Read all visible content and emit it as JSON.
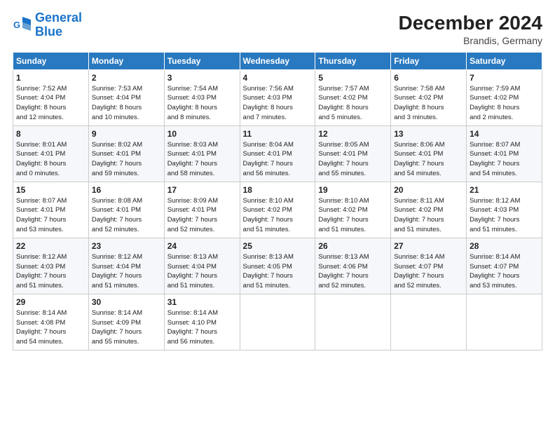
{
  "logo": {
    "line1": "General",
    "line2": "Blue"
  },
  "title": "December 2024",
  "subtitle": "Brandis, Germany",
  "weekdays": [
    "Sunday",
    "Monday",
    "Tuesday",
    "Wednesday",
    "Thursday",
    "Friday",
    "Saturday"
  ],
  "weeks": [
    [
      {
        "day": "1",
        "lines": [
          "Sunrise: 7:52 AM",
          "Sunset: 4:04 PM",
          "Daylight: 8 hours",
          "and 12 minutes."
        ]
      },
      {
        "day": "2",
        "lines": [
          "Sunrise: 7:53 AM",
          "Sunset: 4:04 PM",
          "Daylight: 8 hours",
          "and 10 minutes."
        ]
      },
      {
        "day": "3",
        "lines": [
          "Sunrise: 7:54 AM",
          "Sunset: 4:03 PM",
          "Daylight: 8 hours",
          "and 8 minutes."
        ]
      },
      {
        "day": "4",
        "lines": [
          "Sunrise: 7:56 AM",
          "Sunset: 4:03 PM",
          "Daylight: 8 hours",
          "and 7 minutes."
        ]
      },
      {
        "day": "5",
        "lines": [
          "Sunrise: 7:57 AM",
          "Sunset: 4:02 PM",
          "Daylight: 8 hours",
          "and 5 minutes."
        ]
      },
      {
        "day": "6",
        "lines": [
          "Sunrise: 7:58 AM",
          "Sunset: 4:02 PM",
          "Daylight: 8 hours",
          "and 3 minutes."
        ]
      },
      {
        "day": "7",
        "lines": [
          "Sunrise: 7:59 AM",
          "Sunset: 4:02 PM",
          "Daylight: 8 hours",
          "and 2 minutes."
        ]
      }
    ],
    [
      {
        "day": "8",
        "lines": [
          "Sunrise: 8:01 AM",
          "Sunset: 4:01 PM",
          "Daylight: 8 hours",
          "and 0 minutes."
        ]
      },
      {
        "day": "9",
        "lines": [
          "Sunrise: 8:02 AM",
          "Sunset: 4:01 PM",
          "Daylight: 7 hours",
          "and 59 minutes."
        ]
      },
      {
        "day": "10",
        "lines": [
          "Sunrise: 8:03 AM",
          "Sunset: 4:01 PM",
          "Daylight: 7 hours",
          "and 58 minutes."
        ]
      },
      {
        "day": "11",
        "lines": [
          "Sunrise: 8:04 AM",
          "Sunset: 4:01 PM",
          "Daylight: 7 hours",
          "and 56 minutes."
        ]
      },
      {
        "day": "12",
        "lines": [
          "Sunrise: 8:05 AM",
          "Sunset: 4:01 PM",
          "Daylight: 7 hours",
          "and 55 minutes."
        ]
      },
      {
        "day": "13",
        "lines": [
          "Sunrise: 8:06 AM",
          "Sunset: 4:01 PM",
          "Daylight: 7 hours",
          "and 54 minutes."
        ]
      },
      {
        "day": "14",
        "lines": [
          "Sunrise: 8:07 AM",
          "Sunset: 4:01 PM",
          "Daylight: 7 hours",
          "and 54 minutes."
        ]
      }
    ],
    [
      {
        "day": "15",
        "lines": [
          "Sunrise: 8:07 AM",
          "Sunset: 4:01 PM",
          "Daylight: 7 hours",
          "and 53 minutes."
        ]
      },
      {
        "day": "16",
        "lines": [
          "Sunrise: 8:08 AM",
          "Sunset: 4:01 PM",
          "Daylight: 7 hours",
          "and 52 minutes."
        ]
      },
      {
        "day": "17",
        "lines": [
          "Sunrise: 8:09 AM",
          "Sunset: 4:01 PM",
          "Daylight: 7 hours",
          "and 52 minutes."
        ]
      },
      {
        "day": "18",
        "lines": [
          "Sunrise: 8:10 AM",
          "Sunset: 4:02 PM",
          "Daylight: 7 hours",
          "and 51 minutes."
        ]
      },
      {
        "day": "19",
        "lines": [
          "Sunrise: 8:10 AM",
          "Sunset: 4:02 PM",
          "Daylight: 7 hours",
          "and 51 minutes."
        ]
      },
      {
        "day": "20",
        "lines": [
          "Sunrise: 8:11 AM",
          "Sunset: 4:02 PM",
          "Daylight: 7 hours",
          "and 51 minutes."
        ]
      },
      {
        "day": "21",
        "lines": [
          "Sunrise: 8:12 AM",
          "Sunset: 4:03 PM",
          "Daylight: 7 hours",
          "and 51 minutes."
        ]
      }
    ],
    [
      {
        "day": "22",
        "lines": [
          "Sunrise: 8:12 AM",
          "Sunset: 4:03 PM",
          "Daylight: 7 hours",
          "and 51 minutes."
        ]
      },
      {
        "day": "23",
        "lines": [
          "Sunrise: 8:12 AM",
          "Sunset: 4:04 PM",
          "Daylight: 7 hours",
          "and 51 minutes."
        ]
      },
      {
        "day": "24",
        "lines": [
          "Sunrise: 8:13 AM",
          "Sunset: 4:04 PM",
          "Daylight: 7 hours",
          "and 51 minutes."
        ]
      },
      {
        "day": "25",
        "lines": [
          "Sunrise: 8:13 AM",
          "Sunset: 4:05 PM",
          "Daylight: 7 hours",
          "and 51 minutes."
        ]
      },
      {
        "day": "26",
        "lines": [
          "Sunrise: 8:13 AM",
          "Sunset: 4:06 PM",
          "Daylight: 7 hours",
          "and 52 minutes."
        ]
      },
      {
        "day": "27",
        "lines": [
          "Sunrise: 8:14 AM",
          "Sunset: 4:07 PM",
          "Daylight: 7 hours",
          "and 52 minutes."
        ]
      },
      {
        "day": "28",
        "lines": [
          "Sunrise: 8:14 AM",
          "Sunset: 4:07 PM",
          "Daylight: 7 hours",
          "and 53 minutes."
        ]
      }
    ],
    [
      {
        "day": "29",
        "lines": [
          "Sunrise: 8:14 AM",
          "Sunset: 4:08 PM",
          "Daylight: 7 hours",
          "and 54 minutes."
        ]
      },
      {
        "day": "30",
        "lines": [
          "Sunrise: 8:14 AM",
          "Sunset: 4:09 PM",
          "Daylight: 7 hours",
          "and 55 minutes."
        ]
      },
      {
        "day": "31",
        "lines": [
          "Sunrise: 8:14 AM",
          "Sunset: 4:10 PM",
          "Daylight: 7 hours",
          "and 56 minutes."
        ]
      },
      {
        "day": "",
        "lines": []
      },
      {
        "day": "",
        "lines": []
      },
      {
        "day": "",
        "lines": []
      },
      {
        "day": "",
        "lines": []
      }
    ]
  ]
}
